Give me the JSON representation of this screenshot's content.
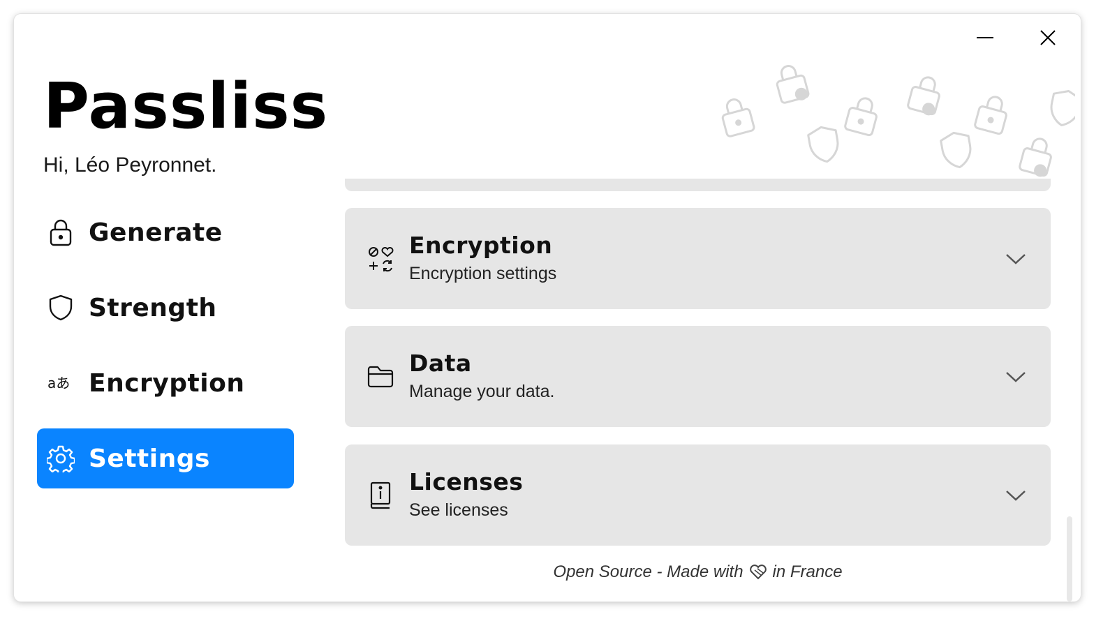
{
  "app": {
    "title": "Passliss",
    "greeting": "Hi, Léo Peyronnet."
  },
  "window_controls": {
    "minimize_icon": "minimize-icon",
    "close_icon": "close-icon"
  },
  "sidebar": {
    "items": [
      {
        "label": "Generate",
        "icon": "lock-icon",
        "active": false
      },
      {
        "label": "Strength",
        "icon": "shield-icon",
        "active": false
      },
      {
        "label": "Encryption",
        "icon": "translate-icon",
        "active": false
      },
      {
        "label": "Settings",
        "icon": "gear-icon",
        "active": true
      }
    ]
  },
  "settings": {
    "sections": [
      {
        "title": "Encryption",
        "subtitle": "Encryption settings",
        "icon": "symbols-icon"
      },
      {
        "title": "Data",
        "subtitle": "Manage your data.",
        "icon": "folder-icon"
      },
      {
        "title": "Licenses",
        "subtitle": "See licenses",
        "icon": "info-book-icon"
      }
    ]
  },
  "footer": {
    "text_before": "Open Source - Made with",
    "text_after": "in France",
    "icon": "heart-icon"
  },
  "colors": {
    "accent": "#0a84ff",
    "card_background": "#e6e6e6",
    "text": "#111111"
  }
}
